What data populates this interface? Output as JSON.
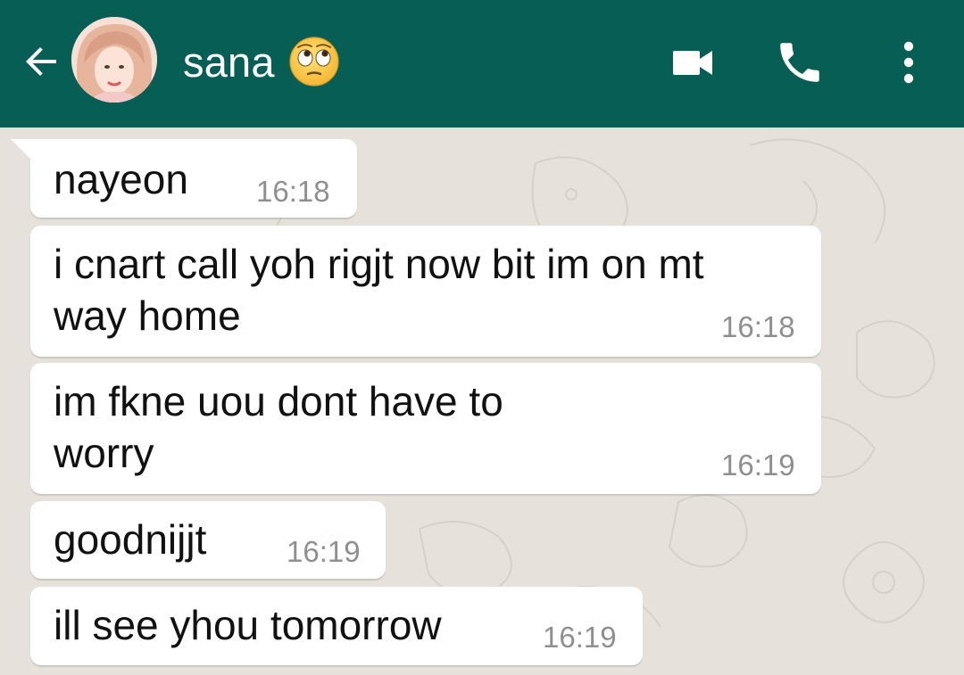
{
  "header": {
    "contact_name": "sana",
    "back_icon": "arrow-back-icon",
    "status_emoji": "face-with-rolling-eyes-icon",
    "video_icon": "videocam-icon",
    "call_icon": "phone-icon",
    "menu_icon": "more-vert-icon",
    "background_color": "#075e54"
  },
  "messages": [
    {
      "text": "nayeon",
      "time": "16:18"
    },
    {
      "text": "i cnart call yoh rigjt now bit im on mt way home",
      "line1": "i cnart call yoh rigjt now bit im on mt",
      "line2": "way home",
      "time": "16:18"
    },
    {
      "text": "im fkne uou dont have to worry",
      "line1": "im fkne uou dont have to",
      "line2": "worry",
      "time": "16:19"
    },
    {
      "text": "goodnijjt",
      "time": "16:19"
    },
    {
      "text": "ill see yhou tomorrow",
      "time": "16:19"
    }
  ]
}
